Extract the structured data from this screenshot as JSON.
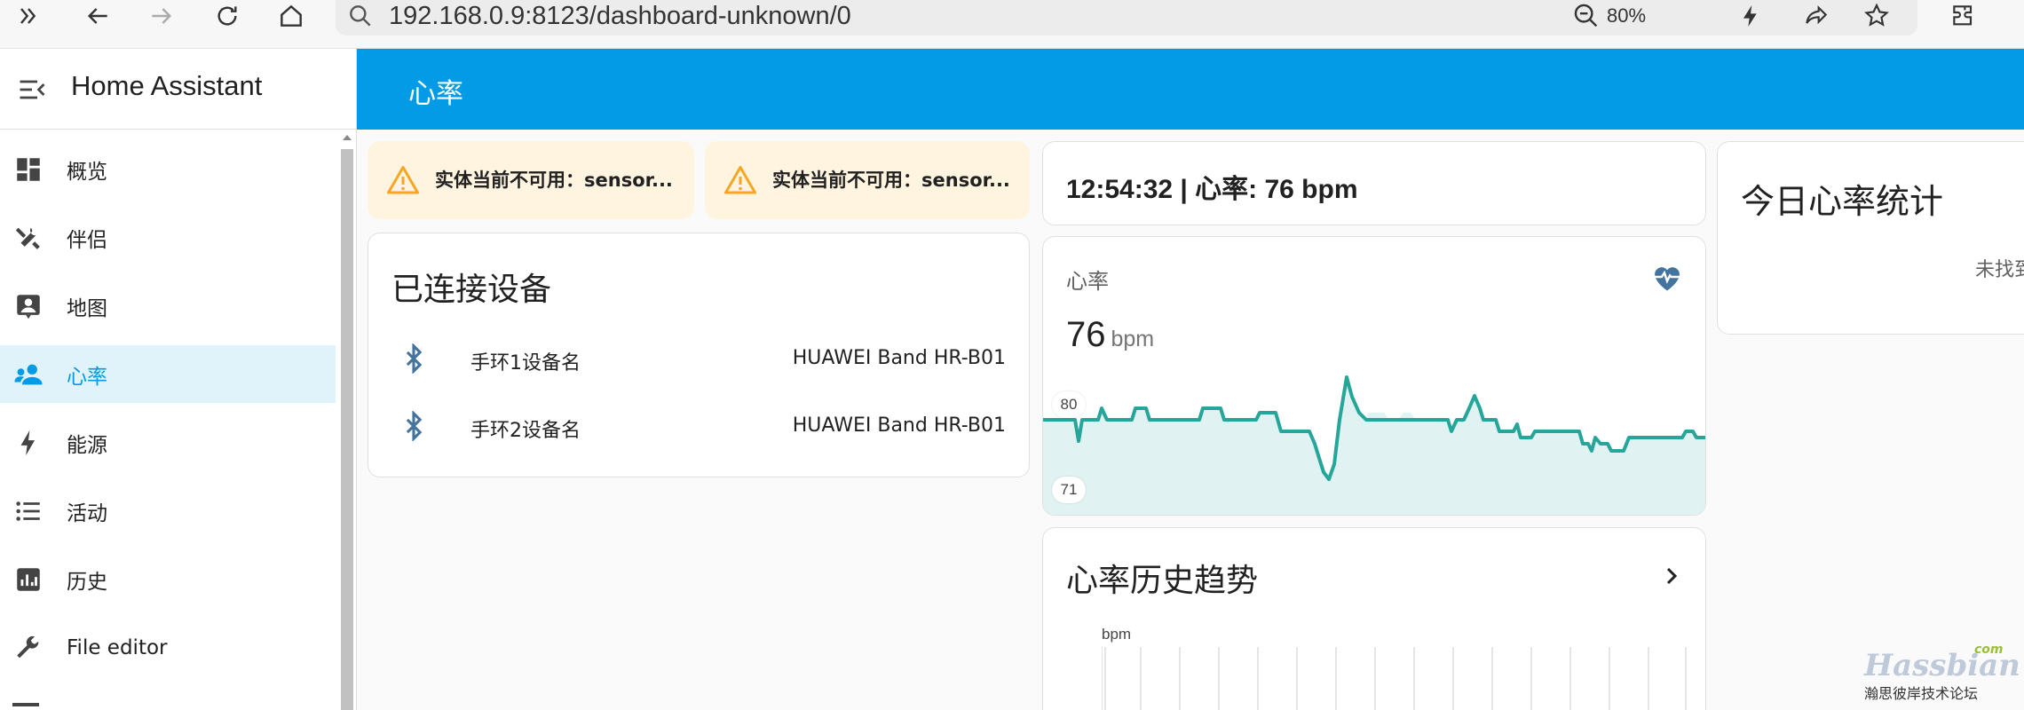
{
  "browser": {
    "url": "192.168.0.9:8123/dashboard-unknown/0",
    "zoom": "80%"
  },
  "app": {
    "title": "Home Assistant",
    "page_title": "心率"
  },
  "sidebar": {
    "items": [
      {
        "label": "概览",
        "icon": "dashboard-icon"
      },
      {
        "label": "伴侣",
        "icon": "tools-icon"
      },
      {
        "label": "地图",
        "icon": "map-person-icon"
      },
      {
        "label": "心率",
        "icon": "people-icon",
        "active": true
      },
      {
        "label": "能源",
        "icon": "lightning-icon"
      },
      {
        "label": "活动",
        "icon": "list-icon"
      },
      {
        "label": "历史",
        "icon": "history-chart-icon"
      },
      {
        "label": "File editor",
        "icon": "wrench-icon"
      }
    ]
  },
  "warnings": [
    {
      "text": "实体当前不可用：sensor..."
    },
    {
      "text": "实体当前不可用：sensor..."
    }
  ],
  "devices": {
    "title": "已连接设备",
    "rows": [
      {
        "name": "手环1设备名",
        "value": "HUAWEI Band HR-B01"
      },
      {
        "name": "手环2设备名",
        "value": "HUAWEI Band HR-B01"
      }
    ]
  },
  "clock": {
    "text": "12:54:32 | 心率: 76 bpm"
  },
  "sensor": {
    "name": "心率",
    "value": "76",
    "unit": "bpm",
    "max_label": "80",
    "min_label": "71",
    "accent": "#26a69a"
  },
  "trend": {
    "title": "心率历史趋势",
    "unit_label": "bpm"
  },
  "stats": {
    "title": "今日心率统计",
    "note": "未找到"
  },
  "watermark": {
    "main": "Hassbian",
    "com": "com",
    "sub": "瀚思彼岸技术论坛"
  },
  "colors": {
    "header": "#039be5",
    "active_bg": "#e1f3fa",
    "warn_bg": "#fff4e0",
    "warn_icon": "#f5a623",
    "bt_blue": "#44739e"
  }
}
